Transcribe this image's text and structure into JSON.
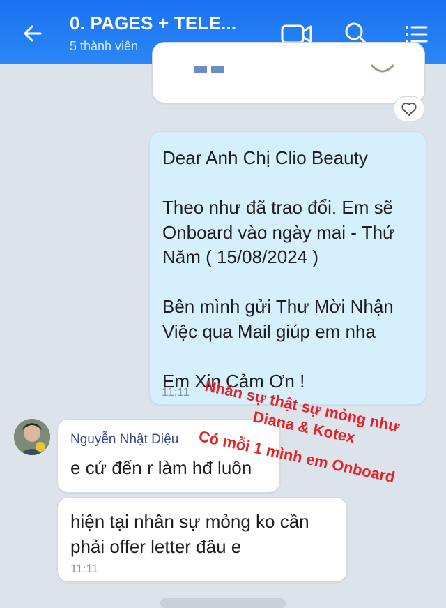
{
  "header": {
    "title": "0. PAGES + TELE...",
    "subtitle": "5 thành viên",
    "accent": "#1a73f0",
    "icons": [
      "back-arrow-icon",
      "video-call-icon",
      "search-icon",
      "menu-list-icon"
    ]
  },
  "messages": {
    "sent": {
      "lines": [
        "Dear Anh Chị Clio Beauty",
        "",
        "Theo như đã trao đổi. Em sẽ",
        "Onboard vào ngày mai - Thứ",
        "Năm ( 15/08/2024 )",
        "",
        "Bên mình gửi Thư Mời Nhận",
        "Việc qua Mail giúp em nha",
        "",
        "Em Xin Cảm Ơn !"
      ],
      "time": "11:11",
      "reaction_icon": "heart-outline-icon"
    },
    "received": [
      {
        "sender": "Nguyễn Nhật Diệu",
        "text": "e cứ đến r làm hđ luôn"
      },
      {
        "lines": [
          "hiện tại nhân sự mỏng ko cần",
          "phải offer letter đâu e"
        ],
        "time": "11:11"
      }
    ]
  },
  "overlay_annotation": {
    "line1": "Nhân sự thật sự mỏng như",
    "line2": "Diana & Kotex",
    "line3": "Có mỗi 1 mình em Onboard",
    "color": "#e32326"
  }
}
